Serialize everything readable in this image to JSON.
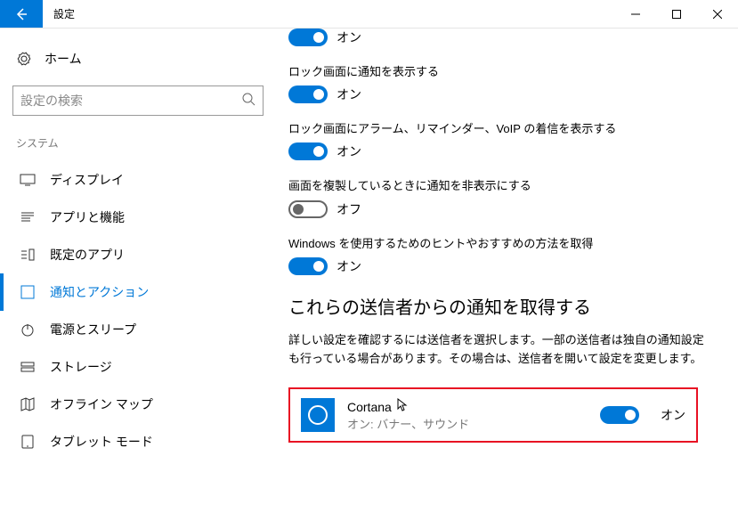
{
  "titlebar": {
    "title": "設定"
  },
  "sidebar": {
    "home": "ホーム",
    "search_placeholder": "設定の検索",
    "section": "システム",
    "items": [
      {
        "label": "ディスプレイ"
      },
      {
        "label": "アプリと機能"
      },
      {
        "label": "既定のアプリ"
      },
      {
        "label": "通知とアクション"
      },
      {
        "label": "電源とスリープ"
      },
      {
        "label": "ストレージ"
      },
      {
        "label": "オフライン マップ"
      },
      {
        "label": "タブレット モード"
      }
    ]
  },
  "content": {
    "partial_state": "オン",
    "settings": [
      {
        "label": "ロック画面に通知を表示する",
        "state": "オン",
        "on": true
      },
      {
        "label": "ロック画面にアラーム、リマインダー、VoIP の着信を表示する",
        "state": "オン",
        "on": true
      },
      {
        "label": "画面を複製しているときに通知を非表示にする",
        "state": "オフ",
        "on": false
      },
      {
        "label": "Windows を使用するためのヒントやおすすめの方法を取得",
        "state": "オン",
        "on": true
      }
    ],
    "senders_title": "これらの送信者からの通知を取得する",
    "senders_desc": "詳しい設定を確認するには送信者を選択します。一部の送信者は独自の通知設定も行っている場合があります。その場合は、送信者を開いて設定を変更します。",
    "sender": {
      "name": "Cortana",
      "sub": "オン: バナー、サウンド",
      "state": "オン"
    }
  }
}
